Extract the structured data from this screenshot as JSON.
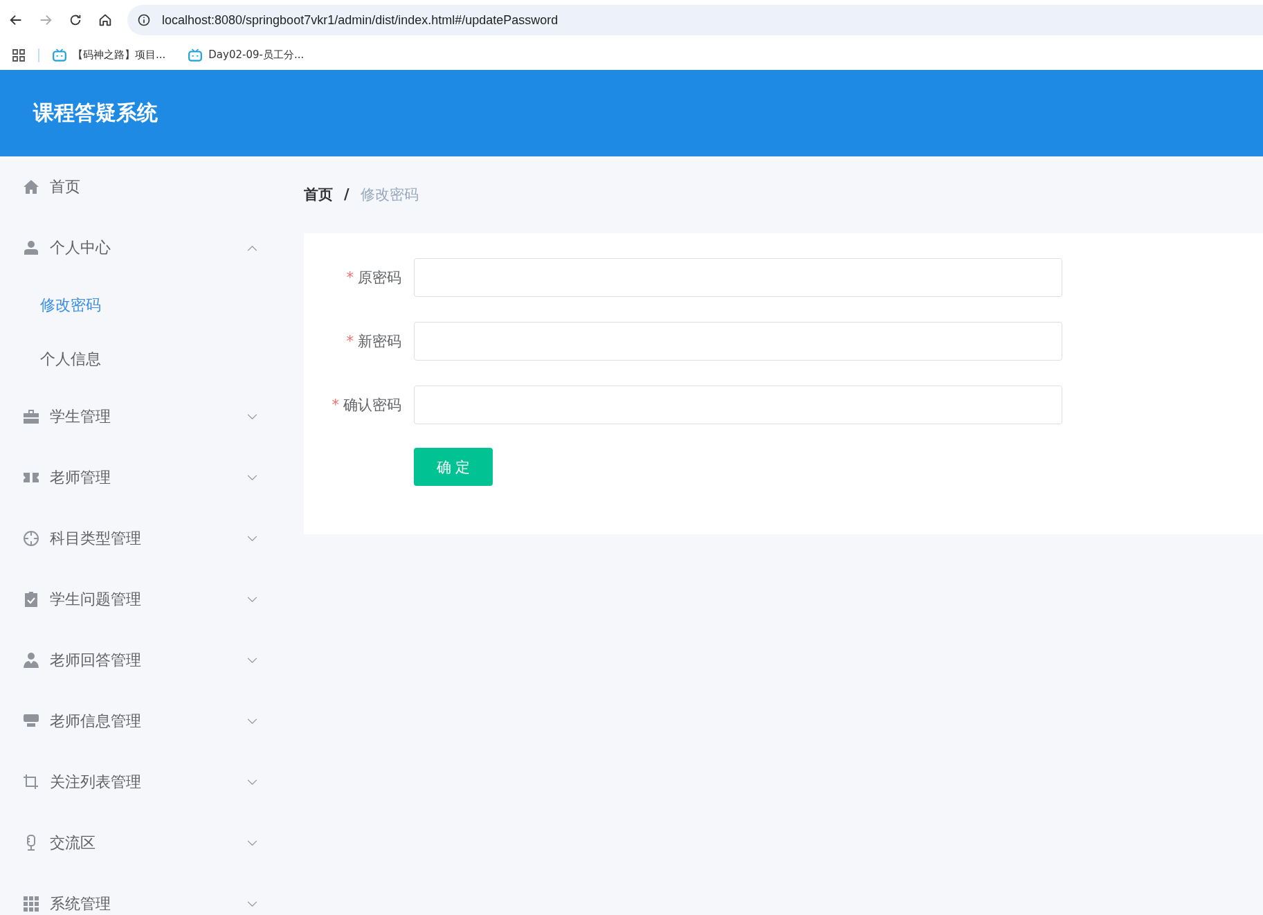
{
  "browser": {
    "nav_buttons": [
      {
        "kind": "back",
        "disabled": false
      },
      {
        "kind": "forward",
        "disabled": true
      },
      {
        "kind": "reload",
        "disabled": false
      },
      {
        "kind": "home",
        "disabled": false
      }
    ],
    "url": "localhost:8080/springboot7vkr1/admin/dist/index.html#/updatePassword",
    "bookmarks": [
      {
        "label": "【码神之路】项目..."
      },
      {
        "label": "Day02-09-员工分..."
      }
    ]
  },
  "header": {
    "title": "课程答疑系统"
  },
  "sidebar": {
    "items": [
      {
        "label": "首页",
        "kind": "link"
      },
      {
        "label": "个人中心",
        "kind": "submenu",
        "expanded": true,
        "children": [
          {
            "label": "修改密码",
            "selected": true
          },
          {
            "label": "个人信息",
            "selected": false
          }
        ]
      },
      {
        "label": "学生管理",
        "kind": "submenu",
        "expanded": false
      },
      {
        "label": "老师管理",
        "kind": "submenu",
        "expanded": false
      },
      {
        "label": "科目类型管理",
        "kind": "submenu",
        "expanded": false
      },
      {
        "label": "学生问题管理",
        "kind": "submenu",
        "expanded": false
      },
      {
        "label": "老师回答管理",
        "kind": "submenu",
        "expanded": false
      },
      {
        "label": "老师信息管理",
        "kind": "submenu",
        "expanded": false
      },
      {
        "label": "关注列表管理",
        "kind": "submenu",
        "expanded": false
      },
      {
        "label": "交流区",
        "kind": "submenu",
        "expanded": false
      },
      {
        "label": "系统管理",
        "kind": "submenu",
        "expanded": false
      }
    ]
  },
  "breadcrumb": {
    "items": [
      "首页",
      "修改密码"
    ],
    "separator": "/"
  },
  "form": {
    "fields": [
      {
        "label": "原密码",
        "required": true
      },
      {
        "label": "新密码",
        "required": true
      },
      {
        "label": "确认密码",
        "required": true
      }
    ],
    "required_mark": "*",
    "submit": "确 定"
  }
}
